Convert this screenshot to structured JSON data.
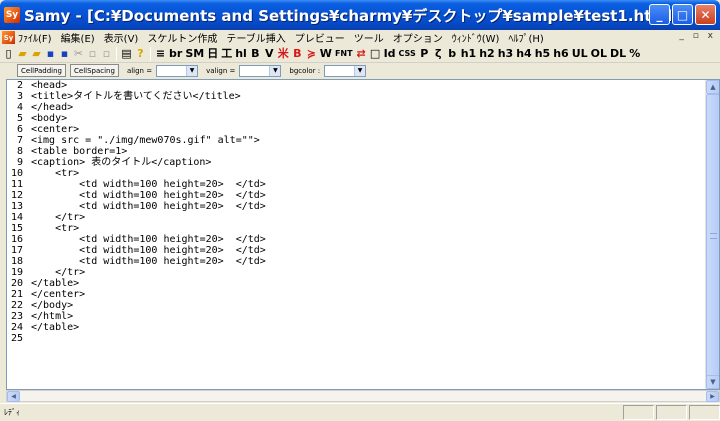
{
  "window": {
    "app_icon_glyph": "Sy",
    "title": "Samy - [C:¥Documents and Settings¥charmy¥デスクトップ¥sample¥test1.html]",
    "controls": {
      "minimize": "_",
      "maximize": "□",
      "close": "✕"
    }
  },
  "menu": {
    "items": [
      "ﾌｧｲﾙ(F)",
      "編集(E)",
      "表示(V)",
      "スケルトン作成",
      "テーブル挿入",
      "プレビュー",
      "ツール",
      "オプション",
      "ｳｨﾝﾄﾞｳ(W)",
      "ﾍﾙﾌﾟ(H)"
    ],
    "mdi_controls": "_ ▫ x"
  },
  "toolbar": {
    "file_buttons": [
      "▯",
      "▰",
      "▰",
      "▪",
      "▪",
      "✂",
      "▫",
      "▫",
      "▤",
      "?"
    ],
    "html_buttons": [
      "≡",
      "br",
      "SM",
      "日",
      "工",
      "hl",
      "B",
      "V",
      "米",
      "B",
      "≽",
      "W",
      "FNT",
      "⇄",
      "□",
      "Id",
      "CSS",
      "P",
      "ζ",
      "b",
      "h1",
      "h2",
      "h3",
      "h4",
      "h5",
      "h6",
      "UL",
      "OL",
      "DL",
      "%"
    ]
  },
  "propbar": {
    "cellpadding": "CellPadding",
    "cellspacing": "CellSpacing",
    "align_label": "align =",
    "valign_label": "valign =",
    "bgcolor_label": "bgcolor :",
    "align_value": "",
    "valign_value": "",
    "bgcolor_value": ""
  },
  "editor": {
    "lines": [
      {
        "no": "2",
        "text": "<head>"
      },
      {
        "no": "3",
        "text": "<title>タイトルを書いてください</title>"
      },
      {
        "no": "4",
        "text": "</head>"
      },
      {
        "no": "5",
        "text": "<body>"
      },
      {
        "no": "6",
        "text": "<center>"
      },
      {
        "no": "7",
        "text": "<img src = \"./img/mew070s.gif\" alt=\"\">"
      },
      {
        "no": "8",
        "text": "<table border=1>"
      },
      {
        "no": "9",
        "text": "<caption> 表のタイトル</caption>"
      },
      {
        "no": "10",
        "text": "    <tr>"
      },
      {
        "no": "11",
        "text": "        <td width=100 height=20>  </td>"
      },
      {
        "no": "12",
        "text": "        <td width=100 height=20>  </td>"
      },
      {
        "no": "13",
        "text": "        <td width=100 height=20>  </td>"
      },
      {
        "no": "14",
        "text": "    </tr>"
      },
      {
        "no": "15",
        "text": "    <tr>"
      },
      {
        "no": "16",
        "text": "        <td width=100 height=20>  </td>"
      },
      {
        "no": "17",
        "text": "        <td width=100 height=20>  </td>"
      },
      {
        "no": "18",
        "text": "        <td width=100 height=20>  </td>"
      },
      {
        "no": "19",
        "text": "    </tr>"
      },
      {
        "no": "20",
        "text": "</table>"
      },
      {
        "no": "21",
        "text": "</center>"
      },
      {
        "no": "22",
        "text": "</body>"
      },
      {
        "no": "23",
        "text": "</html>"
      },
      {
        "no": "24",
        "text": "</table>"
      },
      {
        "no": "25",
        "text": ""
      }
    ]
  },
  "status": {
    "text": "ﾚﾃﾞｨ"
  }
}
